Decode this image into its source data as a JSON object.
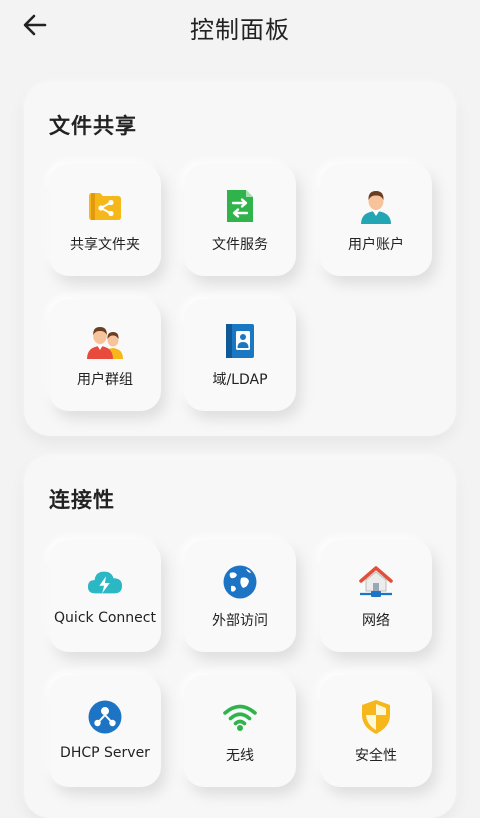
{
  "header": {
    "title": "控制面板"
  },
  "sections": [
    {
      "title": "文件共享",
      "items": [
        {
          "label": "共享文件夹",
          "icon": "shared-folder-icon"
        },
        {
          "label": "文件服务",
          "icon": "file-services-icon"
        },
        {
          "label": "用户账户",
          "icon": "user-icon"
        },
        {
          "label": "用户群组",
          "icon": "user-group-icon"
        },
        {
          "label": "域/LDAP",
          "icon": "address-book-icon"
        }
      ]
    },
    {
      "title": "连接性",
      "items": [
        {
          "label": "Quick Connect",
          "icon": "cloud-lightning-icon"
        },
        {
          "label": "外部访问",
          "icon": "globe-icon"
        },
        {
          "label": "网络",
          "icon": "home-network-icon"
        },
        {
          "label": "DHCP Server",
          "icon": "dhcp-icon"
        },
        {
          "label": "无线",
          "icon": "wifi-icon"
        },
        {
          "label": "安全性",
          "icon": "shield-icon"
        }
      ]
    }
  ],
  "colors": {
    "background": "#f3f3f3",
    "folder": "#f5b71a",
    "file_service": "#2fb34a",
    "user_shirt": "#22a6b3",
    "address_book": "#1a78c2",
    "cloud": "#2bb7c4",
    "globe": "#1e74c4",
    "house_roof": "#e0513a",
    "dhcp": "#1e74c4",
    "wifi": "#2fb34a",
    "shield": "#f5b71a"
  }
}
